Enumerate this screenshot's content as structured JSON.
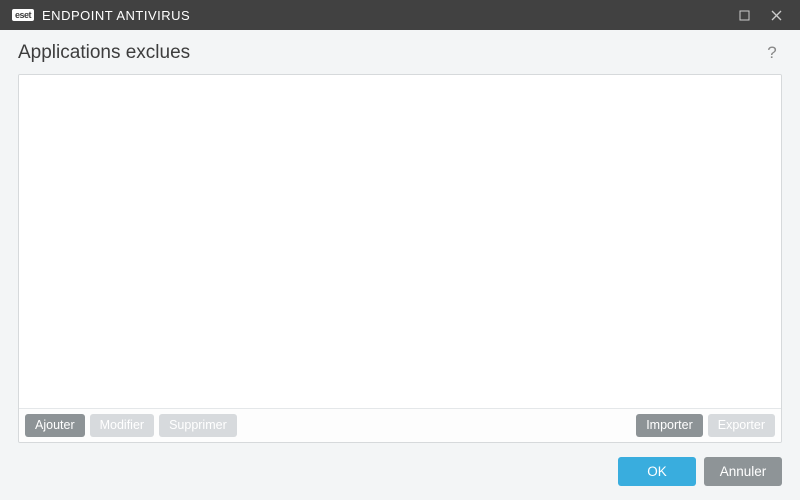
{
  "titlebar": {
    "brand_box": "eset",
    "brand_text": "ENDPOINT ANTIVIRUS"
  },
  "header": {
    "title": "Applications exclues",
    "help": "?"
  },
  "list": {
    "items": []
  },
  "toolbar": {
    "add": "Ajouter",
    "edit": "Modifier",
    "delete": "Supprimer",
    "import": "Importer",
    "export": "Exporter"
  },
  "footer": {
    "ok": "OK",
    "cancel": "Annuler"
  }
}
